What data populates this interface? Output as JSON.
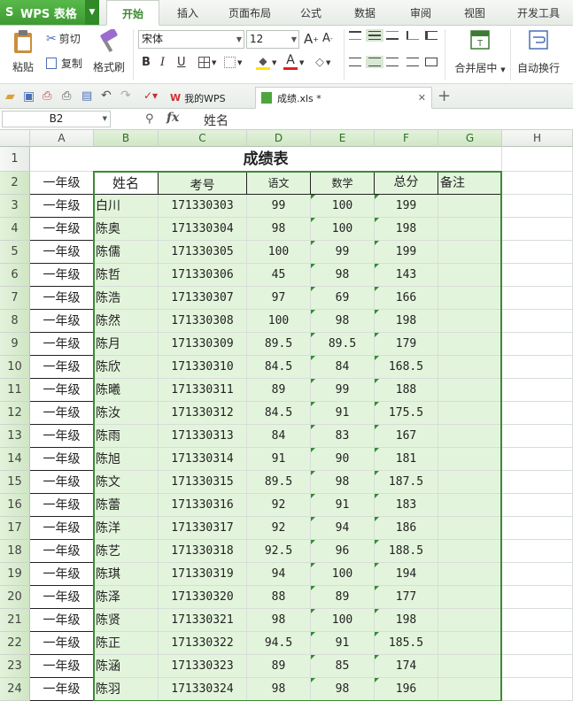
{
  "app": {
    "name": "WPS 表格"
  },
  "menu_tabs": [
    "开始",
    "插入",
    "页面布局",
    "公式",
    "数据",
    "审阅",
    "视图",
    "开发工具"
  ],
  "ribbon": {
    "paste": "粘贴",
    "cut": "剪切",
    "copy": "复制",
    "format_painter": "格式刷",
    "font_name": "宋体",
    "font_size": "12",
    "merge_center": "合并居中",
    "wrap_text": "自动换行"
  },
  "doc_tabs": {
    "home": "我的WPS",
    "file": "成绩.xls *"
  },
  "formula_bar": {
    "cell_ref": "B2",
    "fx": "fx",
    "content": "姓名"
  },
  "columns": [
    "A",
    "B",
    "C",
    "D",
    "E",
    "F",
    "G",
    "H"
  ],
  "sheet": {
    "title": "成绩表",
    "headers": [
      "姓名",
      "考号",
      "语文",
      "数学",
      "总分",
      "备注"
    ],
    "grade": "一年级",
    "rows": [
      [
        "白川",
        "171330303",
        "99",
        "100",
        "199"
      ],
      [
        "陈奥",
        "171330304",
        "98",
        "100",
        "198"
      ],
      [
        "陈儒",
        "171330305",
        "100",
        "99",
        "199"
      ],
      [
        "陈哲",
        "171330306",
        "45",
        "98",
        "143"
      ],
      [
        "陈浩",
        "171330307",
        "97",
        "69",
        "166"
      ],
      [
        "陈然",
        "171330308",
        "100",
        "98",
        "198"
      ],
      [
        "陈月",
        "171330309",
        "89.5",
        "89.5",
        "179"
      ],
      [
        "陈欣",
        "171330310",
        "84.5",
        "84",
        "168.5"
      ],
      [
        "陈曦",
        "171330311",
        "89",
        "99",
        "188"
      ],
      [
        "陈汝",
        "171330312",
        "84.5",
        "91",
        "175.5"
      ],
      [
        "陈雨",
        "171330313",
        "84",
        "83",
        "167"
      ],
      [
        "陈旭",
        "171330314",
        "91",
        "90",
        "181"
      ],
      [
        "陈文",
        "171330315",
        "89.5",
        "98",
        "187.5"
      ],
      [
        "陈蕾",
        "171330316",
        "92",
        "91",
        "183"
      ],
      [
        "陈洋",
        "171330317",
        "92",
        "94",
        "186"
      ],
      [
        "陈艺",
        "171330318",
        "92.5",
        "96",
        "188.5"
      ],
      [
        "陈琪",
        "171330319",
        "94",
        "100",
        "194"
      ],
      [
        "陈泽",
        "171330320",
        "88",
        "89",
        "177"
      ],
      [
        "陈贤",
        "171330321",
        "98",
        "100",
        "198"
      ],
      [
        "陈正",
        "171330322",
        "94.5",
        "91",
        "185.5"
      ],
      [
        "陈涵",
        "171330323",
        "89",
        "85",
        "174"
      ],
      [
        "陈羽",
        "171330324",
        "98",
        "98",
        "196"
      ]
    ]
  },
  "row_numbers": [
    "1",
    "2",
    "3",
    "4",
    "5",
    "6",
    "7",
    "8",
    "9",
    "10",
    "11",
    "12",
    "13",
    "14",
    "15",
    "16",
    "17",
    "18",
    "19",
    "20",
    "21",
    "22",
    "23",
    "24"
  ],
  "colors": {
    "accent": "#3e9a33",
    "selection_fill": "#e3f4dc",
    "selection_border": "#3c8a33"
  }
}
